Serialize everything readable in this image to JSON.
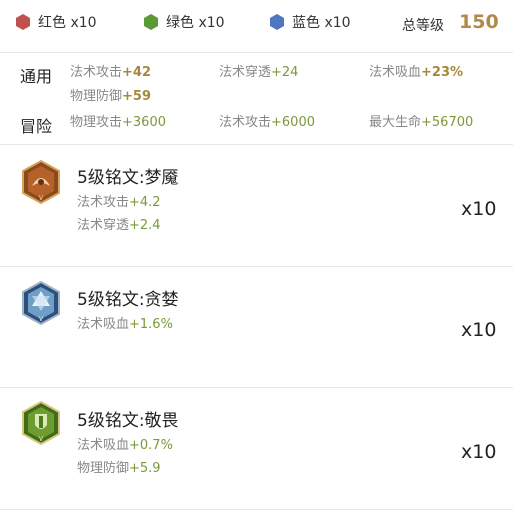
{
  "gems": [
    {
      "label": "红色 x10",
      "color": "#c0504d"
    },
    {
      "label": "绿色 x10",
      "color": "#5a9a34"
    },
    {
      "label": "蓝色 x10",
      "color": "#4f76c2"
    }
  ],
  "total": {
    "label": "总等级",
    "value": "150"
  },
  "general": {
    "label": "通用",
    "stats": [
      {
        "k": "法术攻击",
        "v": "+42"
      },
      {
        "k": "法术穿透",
        "v": "+24"
      },
      {
        "k": "法术吸血",
        "v": "+23%"
      },
      {
        "k": "物理防御",
        "v": "+59"
      }
    ]
  },
  "adventure": {
    "label": "冒险",
    "stats": [
      {
        "k": "物理攻击",
        "v": "+3600"
      },
      {
        "k": "法术攻击",
        "v": "+6000"
      },
      {
        "k": "最大生命",
        "v": "+56700"
      }
    ]
  },
  "runes": [
    {
      "title": "5级铭文:梦魇",
      "icon": "nightmare-rune-icon",
      "color": "#c0504d",
      "lines": [
        {
          "k": "法术攻击",
          "v": "+4.2"
        },
        {
          "k": "法术穿透",
          "v": "+2.4"
        }
      ],
      "count": "x10"
    },
    {
      "title": "5级铭文:贪婪",
      "icon": "greed-rune-icon",
      "color": "#4f76c2",
      "lines": [
        {
          "k": "法术吸血",
          "v": "+1.6%"
        }
      ],
      "count": "x10"
    },
    {
      "title": "5级铭文:敬畏",
      "icon": "awe-rune-icon",
      "color": "#5a9a34",
      "lines": [
        {
          "k": "法术吸血",
          "v": "+0.7%"
        },
        {
          "k": "物理防御",
          "v": "+5.9"
        }
      ],
      "count": "x10"
    }
  ]
}
